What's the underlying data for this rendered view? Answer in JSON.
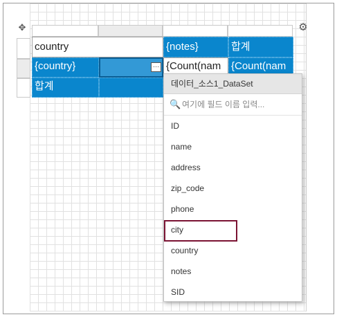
{
  "report": {
    "header_row": {
      "col1": "country",
      "col3": "{notes}",
      "col4": "합계"
    },
    "detail_row": {
      "col1": "{country}",
      "col3": "{Count(nam",
      "col4": "{Count(nam"
    },
    "total_row": {
      "col1": "합계"
    },
    "ellipsis_label": "···"
  },
  "icons": {
    "move": "✥",
    "settings": "⚙",
    "search": "🔍"
  },
  "field_dropdown": {
    "title": "데이터_소스1_DataSet",
    "search_placeholder": "여기에 필드 이름 입력...",
    "fields": [
      "ID",
      "name",
      "address",
      "zip_code",
      "phone",
      "city",
      "country",
      "notes",
      "SID"
    ],
    "highlighted_field": "city"
  },
  "colors": {
    "cell_blue": "#0a86cd",
    "highlight_border": "#7a1232"
  }
}
